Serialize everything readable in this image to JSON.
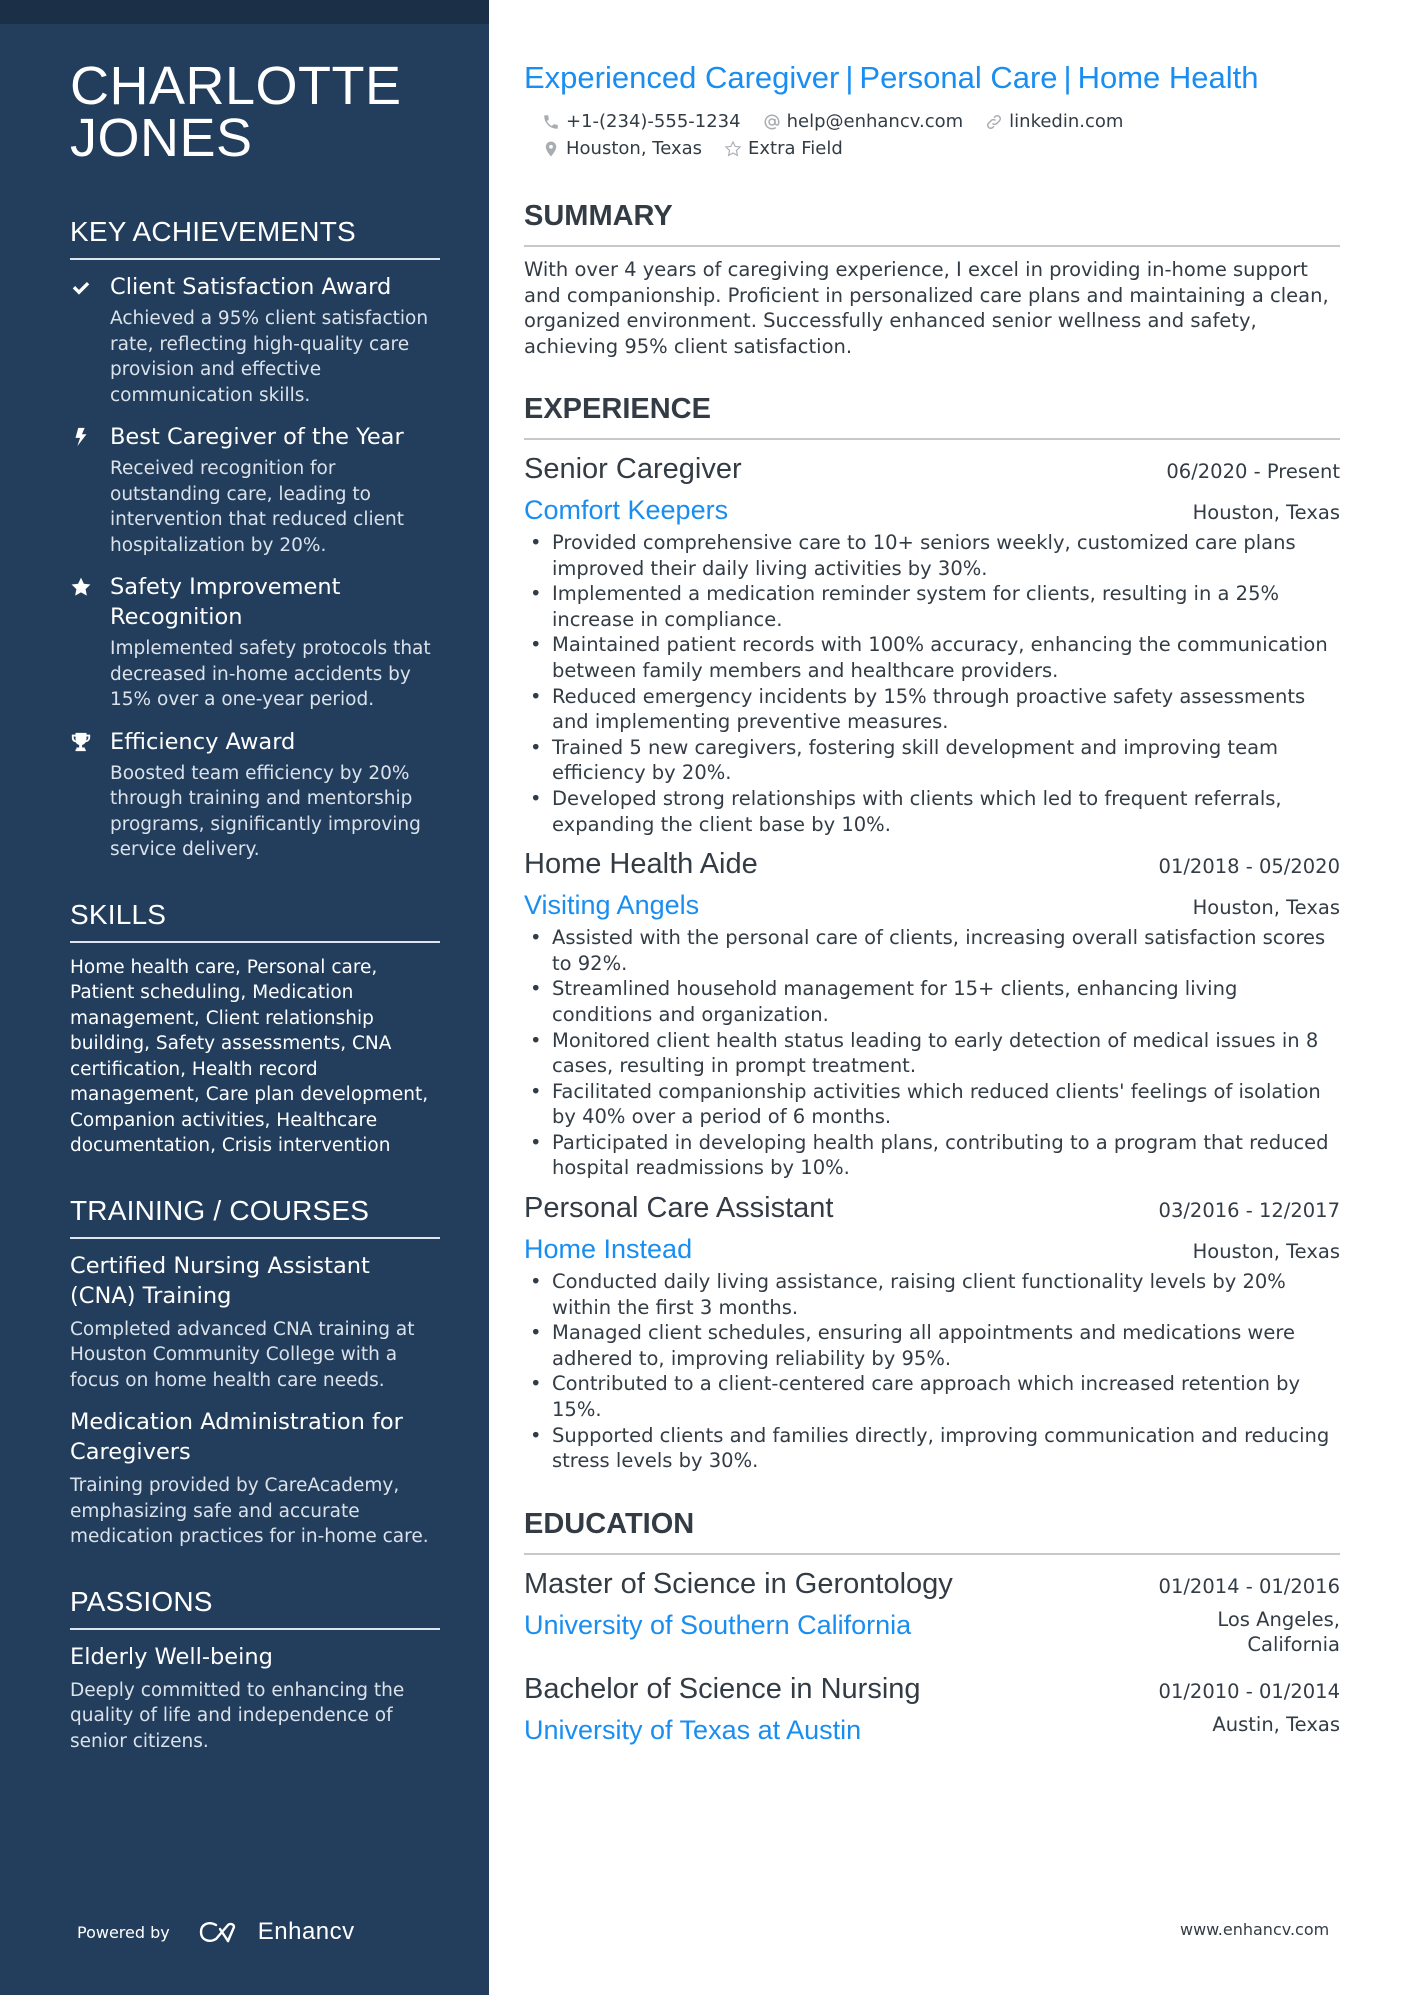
{
  "profile": {
    "name": "CHARLOTTE JONES",
    "headline_parts": [
      "Experienced Caregiver",
      "Personal Care",
      "Home Health"
    ],
    "headline_separator": "|",
    "contacts": {
      "phone": {
        "icon": "phone-icon",
        "value": "+1-(234)-555-1234"
      },
      "email": {
        "icon": "at-icon",
        "value": "help@enhancv.com"
      },
      "link": {
        "icon": "link-icon",
        "value": "linkedin.com"
      },
      "location": {
        "icon": "location-pin-icon",
        "value": "Houston, Texas"
      },
      "extra": {
        "icon": "star-outline-icon",
        "value": "Extra Field"
      }
    }
  },
  "sidebar": {
    "achievements": {
      "heading": "KEY ACHIEVEMENTS",
      "items": [
        {
          "icon": "check-icon",
          "title": "Client Satisfaction Award",
          "desc": "Achieved a 95% client satisfaction rate, reflecting high-quality care provision and effective communication skills."
        },
        {
          "icon": "lightning-icon",
          "title": "Best Caregiver of the Year",
          "desc": "Received recognition for outstanding care, leading to intervention that reduced client hospitalization by 20%."
        },
        {
          "icon": "star-icon",
          "title": "Safety Improvement Recognition",
          "desc": "Implemented safety protocols that decreased in-home accidents by 15% over a one-year period."
        },
        {
          "icon": "trophy-icon",
          "title": "Efficiency Award",
          "desc": "Boosted team efficiency by 20% through training and mentorship programs, significantly improving service delivery."
        }
      ]
    },
    "skills": {
      "heading": "SKILLS",
      "text": "Home health care, Personal care, Patient scheduling, Medication management, Client relationship building, Safety assessments, CNA certification, Health record management, Care plan development, Companion activities, Healthcare documentation, Crisis intervention"
    },
    "training": {
      "heading": "TRAINING / COURSES",
      "items": [
        {
          "title": "Certified Nursing Assistant (CNA) Training",
          "desc": "Completed advanced CNA training at Houston Community College with a focus on home health care needs."
        },
        {
          "title": "Medication Administration for Caregivers",
          "desc": "Training provided by CareAcademy, emphasizing safe and accurate medication practices for in-home care."
        }
      ]
    },
    "passions": {
      "heading": "PASSIONS",
      "items": [
        {
          "title": "Elderly Well-being",
          "desc": "Deeply committed to enhancing the quality of life and independence of senior citizens."
        }
      ]
    },
    "powered_by": "Powered by",
    "brand": "Enhancv"
  },
  "summary": {
    "heading": "SUMMARY",
    "text": "With over 4 years of caregiving experience, I excel in providing in-home support and companionship. Proficient in personalized care plans and maintaining a clean, organized environment. Successfully enhanced senior wellness and safety, achieving 95% client satisfaction."
  },
  "experience": {
    "heading": "EXPERIENCE",
    "jobs": [
      {
        "title": "Senior Caregiver",
        "dates": "06/2020 - Present",
        "company": "Comfort Keepers",
        "location": "Houston, Texas",
        "bullets": [
          "Provided comprehensive care to 10+ seniors weekly, customized care plans improved their daily living activities by 30%.",
          "Implemented a medication reminder system for clients, resulting in a 25% increase in compliance.",
          "Maintained patient records with 100% accuracy, enhancing the communication between family members and healthcare providers.",
          "Reduced emergency incidents by 15% through proactive safety assessments and implementing preventive measures.",
          "Trained 5 new caregivers, fostering skill development and improving team efficiency by 20%.",
          "Developed strong relationships with clients which led to frequent referrals, expanding the client base by 10%."
        ]
      },
      {
        "title": "Home Health Aide",
        "dates": "01/2018 - 05/2020",
        "company": "Visiting Angels",
        "location": "Houston, Texas",
        "bullets": [
          "Assisted with the personal care of clients, increasing overall satisfaction scores to 92%.",
          "Streamlined household management for 15+ clients, enhancing living conditions and organization.",
          "Monitored client health status leading to early detection of medical issues in 8 cases, resulting in prompt treatment.",
          "Facilitated companionship activities which reduced clients' feelings of isolation by 40% over a period of 6 months.",
          "Participated in developing health plans, contributing to a program that reduced hospital readmissions by 10%."
        ]
      },
      {
        "title": "Personal Care Assistant",
        "dates": "03/2016 - 12/2017",
        "company": "Home Instead",
        "location": "Houston, Texas",
        "bullets": [
          "Conducted daily living assistance, raising client functionality levels by 20% within the first 3 months.",
          "Managed client schedules, ensuring all appointments and medications were adhered to, improving reliability by 95%.",
          "Contributed to a client-centered care approach which increased retention by 15%.",
          "Supported clients and families directly, improving communication and reducing stress levels by 30%."
        ]
      }
    ]
  },
  "education": {
    "heading": "EDUCATION",
    "items": [
      {
        "degree": "Master of Science in Gerontology",
        "dates": "01/2014 - 01/2016",
        "school": "University of Southern California",
        "location": "Los Angeles, California"
      },
      {
        "degree": "Bachelor of Science in Nursing",
        "dates": "01/2010 - 01/2014",
        "school": "University of Texas at Austin",
        "location": "Austin, Texas"
      }
    ]
  },
  "footer": {
    "url": "www.enhancv.com"
  },
  "colors": {
    "sidebar": "#223e5c",
    "sidebar_top": "#1b2f46",
    "accent": "#1a8ef0",
    "text": "#333c45"
  }
}
